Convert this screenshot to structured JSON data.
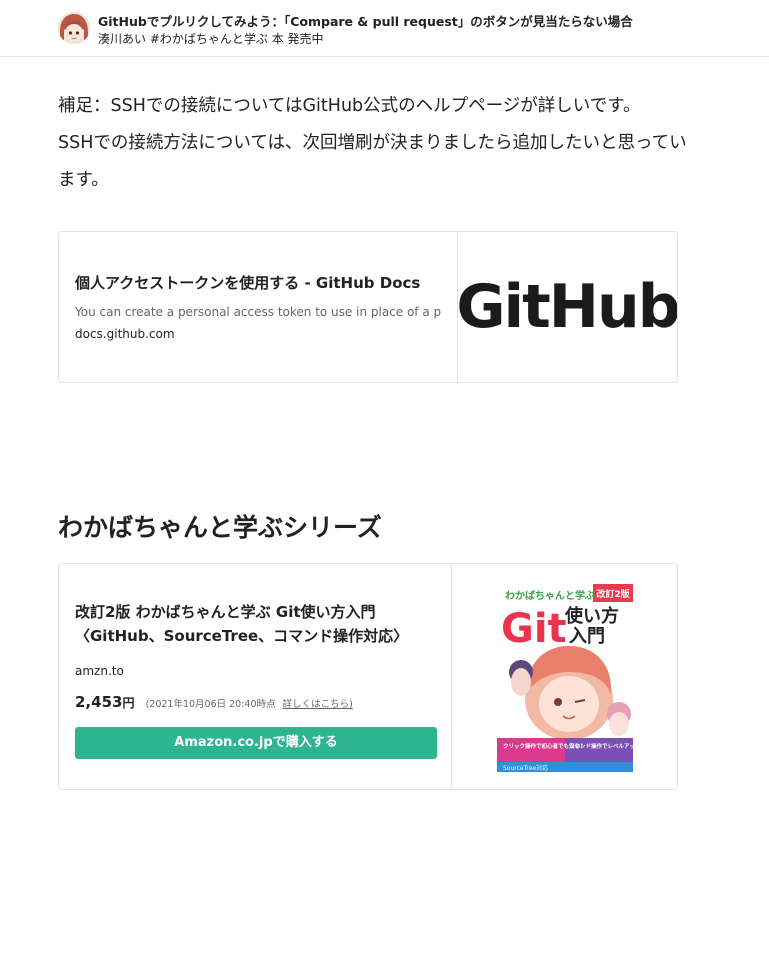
{
  "header": {
    "title": "GitHubでプルリクしてみよう：「Compare & pull request」のボタンが見当たらない場合",
    "author": "湊川あい",
    "tagline": "#わかばちゃんと学ぶ 本 発売中"
  },
  "body": {
    "line1": "補足：SSHでの接続についてはGitHub公式のヘルプページが詳しいです。",
    "line2": "SSHでの接続方法については、次回増刷が決まりましたら追加したいと思っています。"
  },
  "link_card": {
    "title": "個人アクセストークンを使用する - GitHub Docs",
    "description": "You can create a personal access token to use in place of a p",
    "domain": "docs.github.com",
    "thumbnail_text": "GitHub"
  },
  "section": {
    "heading": "わかばちゃんと学ぶシリーズ"
  },
  "product_card": {
    "title": "改訂2版 わかばちゃんと学ぶ Git使い方入門〈GitHub、SourceTree、コマンド操作対応〉",
    "domain": "amzn.to",
    "price": "2,453",
    "price_unit": "円",
    "price_note": "(2021年10月06日 20:40時点",
    "price_detail_link": "詳しくはこちら)",
    "buy_label": "Amazon.co.jpで購入する",
    "cover": {
      "series": "わかばちゃんと学ぶ",
      "edition": "改訂2版",
      "git": "Git",
      "title_a": "使い方",
      "title_b": "入門",
      "badge_left": "クリック操作で初心者でも安心！",
      "badge_right": "コマンド操作でレベルアップも可能！",
      "badge_sourcetree": "SourceTree対応"
    }
  },
  "colors": {
    "accent": "#2db590",
    "text": "#222222",
    "muted": "#666666",
    "border": "#e3e3e3"
  }
}
